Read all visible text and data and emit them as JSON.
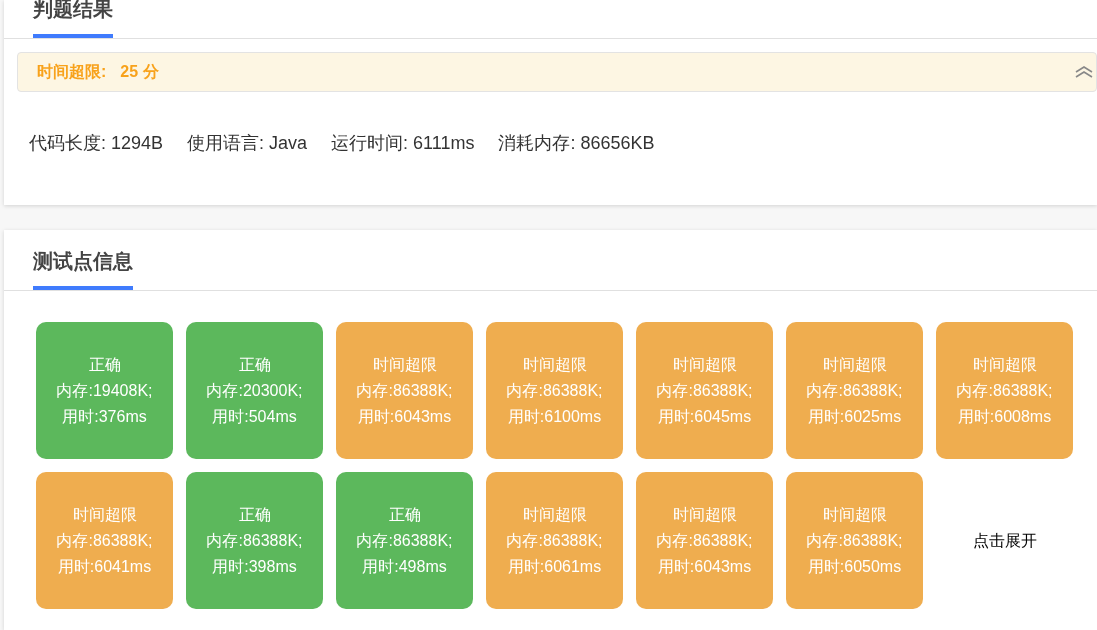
{
  "result_card": {
    "tab": {
      "label": "判题结果",
      "selected": true
    },
    "verdict": {
      "label": "时间超限:",
      "score": "25 分",
      "expanded": true
    },
    "stats": [
      "代码长度: 1294B",
      "使用语言: Java",
      "运行时间: 6111ms",
      "消耗内存: 86656KB"
    ]
  },
  "testcase_card": {
    "tab": {
      "label": "测试点信息",
      "selected": true
    },
    "cases": [
      {
        "kind": "accepted",
        "status": "正确",
        "memory": "内存:19408K;",
        "time": "用时:376ms"
      },
      {
        "kind": "accepted",
        "status": "正确",
        "memory": "内存:20300K;",
        "time": "用时:504ms"
      },
      {
        "kind": "time_limit",
        "status": "时间超限",
        "memory": "内存:86388K;",
        "time": "用时:6043ms"
      },
      {
        "kind": "time_limit",
        "status": "时间超限",
        "memory": "内存:86388K;",
        "time": "用时:6100ms"
      },
      {
        "kind": "time_limit",
        "status": "时间超限",
        "memory": "内存:86388K;",
        "time": "用时:6045ms"
      },
      {
        "kind": "time_limit",
        "status": "时间超限",
        "memory": "内存:86388K;",
        "time": "用时:6025ms"
      },
      {
        "kind": "time_limit",
        "status": "时间超限",
        "memory": "内存:86388K;",
        "time": "用时:6008ms"
      },
      {
        "kind": "time_limit",
        "status": "时间超限",
        "memory": "内存:86388K;",
        "time": "用时:6041ms"
      },
      {
        "kind": "accepted",
        "status": "正确",
        "memory": "内存:86388K;",
        "time": "用时:398ms"
      },
      {
        "kind": "accepted",
        "status": "正确",
        "memory": "内存:86388K;",
        "time": "用时:498ms"
      },
      {
        "kind": "time_limit",
        "status": "时间超限",
        "memory": "内存:86388K;",
        "time": "用时:6061ms"
      },
      {
        "kind": "time_limit",
        "status": "时间超限",
        "memory": "内存:86388K;",
        "time": "用时:6043ms"
      },
      {
        "kind": "time_limit",
        "status": "时间超限",
        "memory": "内存:86388K;",
        "time": "用时:6050ms"
      }
    ],
    "expand_link": "点击展开"
  }
}
